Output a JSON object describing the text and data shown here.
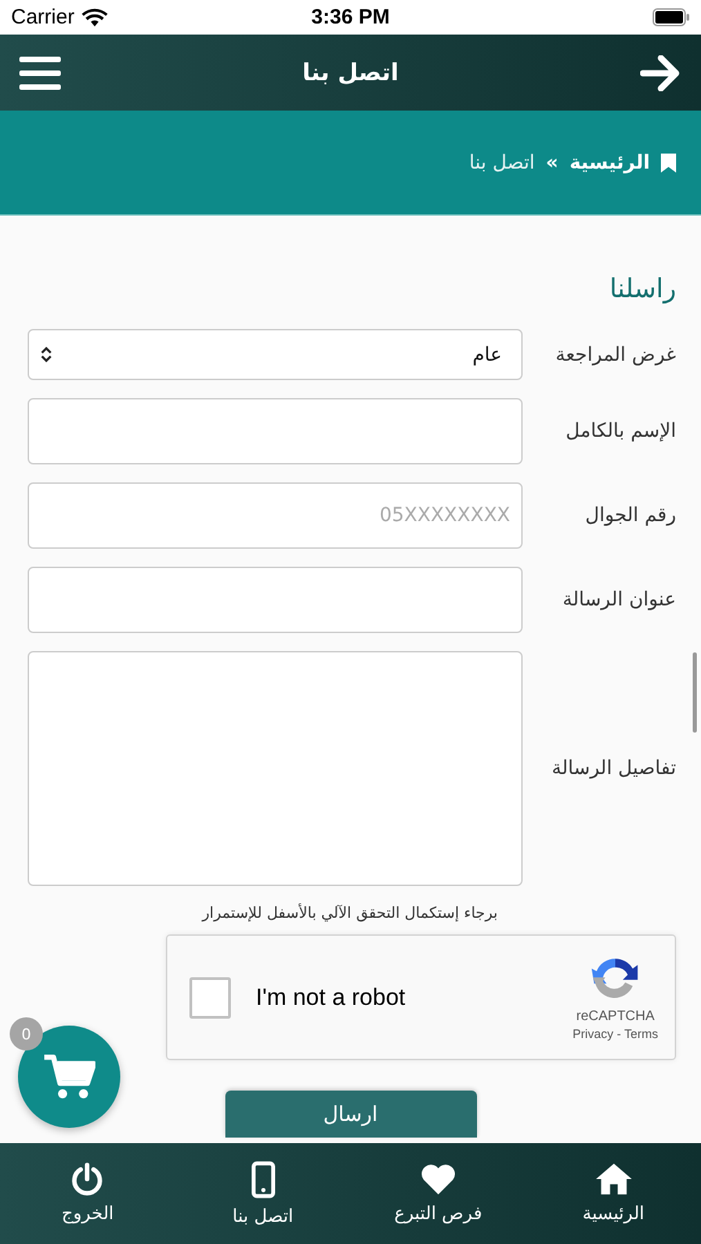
{
  "status_bar": {
    "carrier": "Carrier",
    "time": "3:36 PM"
  },
  "header": {
    "title": "اتصل بنا"
  },
  "breadcrumb": {
    "home": "الرئيسية",
    "separator": "»",
    "current": "اتصل بنا"
  },
  "form": {
    "title": "راسلنا",
    "fields": [
      {
        "kind": "select",
        "label": "غرض المراجعة",
        "value": "عام"
      },
      {
        "kind": "text",
        "label": "الإسم بالكامل"
      },
      {
        "kind": "text",
        "label": "رقم الجوال",
        "placeholder": "05XXXXXXXX"
      },
      {
        "kind": "text",
        "label": "عنوان الرسالة"
      },
      {
        "kind": "textarea",
        "label": "تفاصيل الرسالة"
      }
    ],
    "captcha_note": "برجاء إستكمال التحقق الآلي بالأسفل للإستمرار",
    "captcha": {
      "label": "I'm not a robot",
      "checked": false,
      "brand": "reCAPTCHA",
      "links": "Privacy - Terms"
    },
    "submit": "ارسال"
  },
  "cart": {
    "count": "0"
  },
  "tab_bar": [
    {
      "kind": "home",
      "label": "الرئيسية"
    },
    {
      "kind": "heart",
      "label": "فرص التبرع"
    },
    {
      "kind": "phone",
      "label": "اتصل بنا"
    },
    {
      "kind": "power",
      "label": "الخروج"
    }
  ]
}
